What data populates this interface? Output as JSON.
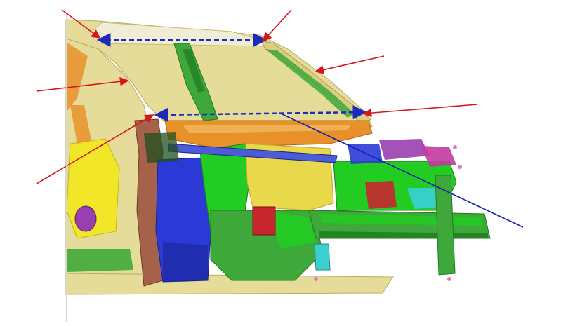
{
  "diagram": {
    "subject": "body-in-white-front-structure",
    "colors": {
      "body_shell": "#e6dc9a",
      "body_shell_dark": "#c9bd6e",
      "roof_rail": "#f0edd6",
      "pillar_green": "#3fa83a",
      "green_bright": "#22cc22",
      "green_dark": "#1f7a1f",
      "orange": "#e8902a",
      "orange_light": "#f3b45a",
      "blue": "#2b3ad6",
      "blue_dark": "#1a238f",
      "yellow": "#f2e629",
      "red": "#c8262f",
      "brown": "#a6614a",
      "purple": "#9a3fb0",
      "cyan": "#3ad0d0",
      "magenta": "#c33a9c",
      "callout_red": "#d6151b",
      "callout_blue": "#1020b0",
      "dimension_dash": "#1d2bb8"
    }
  }
}
